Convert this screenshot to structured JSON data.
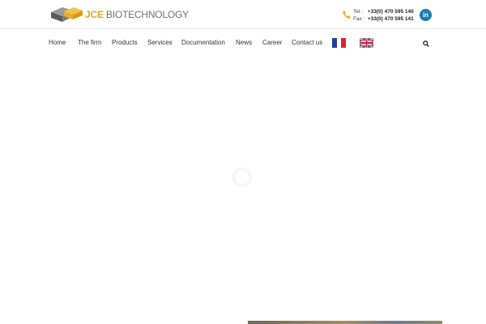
{
  "header": {
    "logo": {
      "brand": "JCE",
      "name": "BIOTECHNOLOGY"
    },
    "contact": {
      "tel_label": "Tel :",
      "tel_value": "+33(0) 470 595 140",
      "fax_label": "Fax :",
      "fax_value": "+33(0) 470 595 141"
    },
    "social": {
      "linkedin_label": "in"
    }
  },
  "nav": {
    "items": [
      "Home",
      "The firm",
      "Products",
      "Services",
      "Documentation",
      "News",
      "Career",
      "Contact us"
    ],
    "languages": [
      "fr-flag-icon",
      "uk-flag-icon"
    ]
  },
  "colors": {
    "brand": "#e3a520",
    "linkedin": "#1a7ab3"
  }
}
